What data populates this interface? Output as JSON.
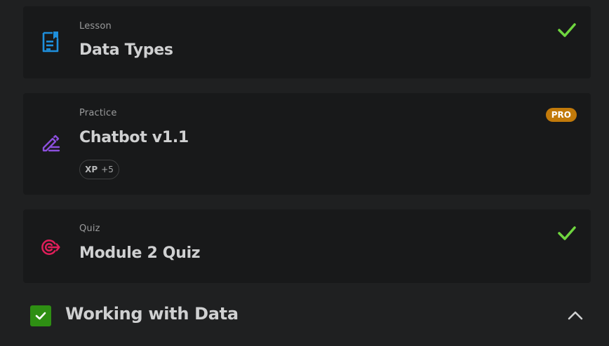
{
  "items": [
    {
      "kind": "Lesson",
      "title": "Data Types",
      "icon": "document-icon",
      "icon_color": "#1e8fdc",
      "completed": true
    },
    {
      "kind": "Practice",
      "title": "Chatbot v1.1",
      "icon": "pencil-icon",
      "icon_color": "#8b4fdc",
      "badge": "PRO",
      "xp_label": "XP",
      "xp_value": "+5",
      "completed": false
    },
    {
      "kind": "Quiz",
      "title": "Module 2 Quiz",
      "icon": "target-icon",
      "icon_color": "#e01e5a",
      "completed": true
    }
  ],
  "section": {
    "title": "Working with Data",
    "completed": true,
    "expanded": true
  },
  "colors": {
    "check_green": "#6fd63f",
    "pro_badge": "#c27a0a",
    "section_check_bg": "#2e8f13"
  }
}
